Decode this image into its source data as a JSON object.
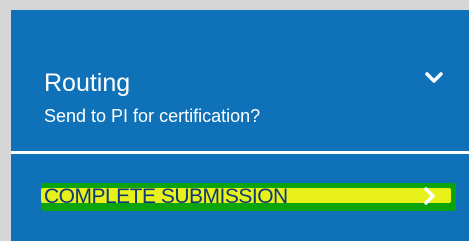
{
  "routing": {
    "title": "Routing",
    "subtitle": "Send to PI for certification?",
    "toggle_icon": "chevron-down-icon"
  },
  "action": {
    "label": "COMPLETE SUBMISSION",
    "icon": "chevron-right-icon",
    "highlighted": true
  },
  "colors": {
    "panel_background": "#0f71b7",
    "page_background": "#d6d6d6",
    "text": "#ffffff",
    "highlight_yellow": "#e9f11b",
    "highlight_green": "#0ca40c",
    "action_text": "#0a3a7a"
  }
}
